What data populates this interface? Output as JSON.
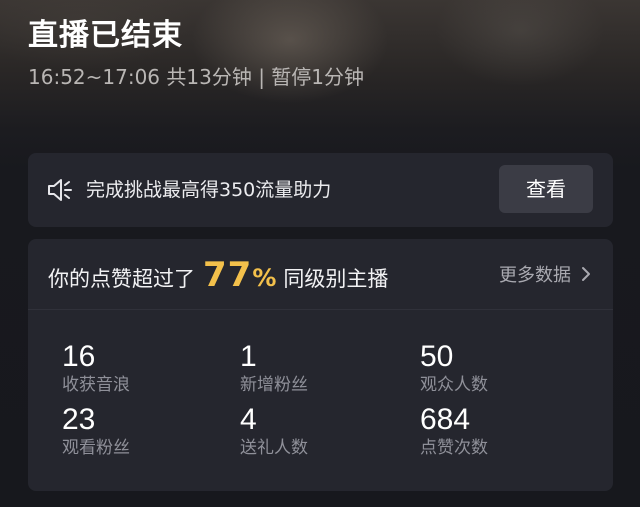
{
  "header": {
    "title": "直播已结束",
    "subtitle": "16:52~17:06 共13分钟 | 暂停1分钟"
  },
  "notice": {
    "text": "完成挑战最高得350流量助力",
    "button_label": "查看"
  },
  "likes": {
    "prefix": "你的点赞超过了",
    "percent_value": "77",
    "percent_sign": "%",
    "suffix": "同级别主播",
    "more_label": "更多数据"
  },
  "stats": [
    {
      "value": "16",
      "label": "收获音浪"
    },
    {
      "value": "1",
      "label": "新增粉丝"
    },
    {
      "value": "50",
      "label": "观众人数"
    },
    {
      "value": "23",
      "label": "观看粉丝"
    },
    {
      "value": "4",
      "label": "送礼人数"
    },
    {
      "value": "684",
      "label": "点赞次数"
    }
  ],
  "colors": {
    "accent": "#f3c04b",
    "card": "#25262e",
    "button": "#3b3c45"
  }
}
